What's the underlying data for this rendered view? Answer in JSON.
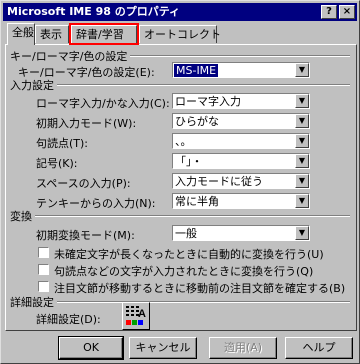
{
  "window": {
    "title": "Microsoft IME 98 のプロパティ"
  },
  "tabs": [
    {
      "label": "全般"
    },
    {
      "label": "表示"
    },
    {
      "label": "辞書/学習"
    },
    {
      "label": "オートコレクト"
    }
  ],
  "key_section": {
    "group": "キー/ローマ字/色の設定",
    "label": "キー/ローマ字/色の設定(E):",
    "value": "MS-IME"
  },
  "input_section": {
    "group": "入力設定",
    "rows": [
      {
        "label": "ローマ字入力/かな入力(C):",
        "value": "ローマ字入力"
      },
      {
        "label": "初期入力モード(W):",
        "value": "ひらがな"
      },
      {
        "label": "句読点(T):",
        "value": "、。"
      },
      {
        "label": "記号(K):",
        "value": "「」・"
      },
      {
        "label": "スペースの入力(P):",
        "value": "入力モードに従う"
      },
      {
        "label": "テンキーからの入力(N):",
        "value": "常に半角"
      }
    ]
  },
  "conversion_section": {
    "group": "変換",
    "label": "初期変換モード(M):",
    "value": "一般",
    "checks": [
      "未確定文字が長くなったときに自動的に変換を行う(U)",
      "句読点などの文字が入力されたときに変換を行う(Q)",
      "注目文節が移動するときに移動前の注目文節を確定する(B)"
    ]
  },
  "detail_section": {
    "group": "詳細設定",
    "label": "詳細設定(D):"
  },
  "buttons": {
    "ok": "OK",
    "cancel": "キャンセル",
    "apply": "適用(A)",
    "help": "ヘルプ"
  }
}
